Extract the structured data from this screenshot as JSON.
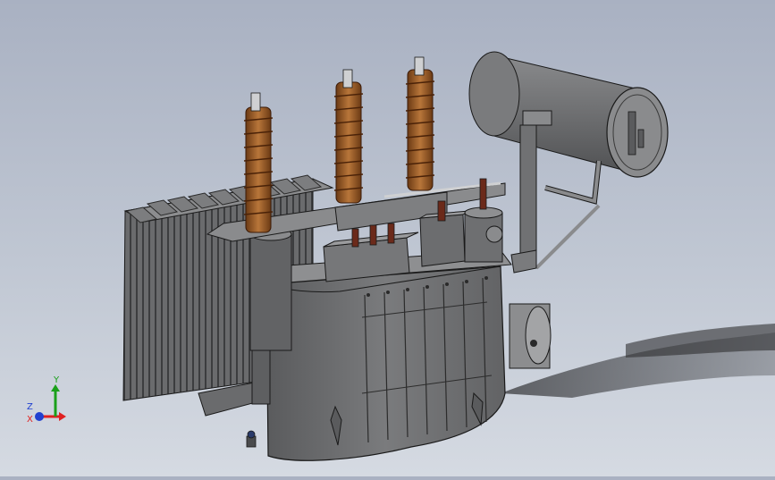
{
  "viewport": {
    "model_icon": "transformer-3d-model",
    "colors": {
      "background_top": "#a9b1c2",
      "background_bottom": "#d5dae2",
      "body": "#6f7072",
      "body_dark": "#4c4d4f",
      "edge": "#1a1a1a",
      "bushing": "#8a4e1e",
      "bushing_light": "#b8763a",
      "shadow": "#3a3b3e"
    }
  },
  "triad": {
    "x_label": "X",
    "y_label": "Y",
    "z_label": "Z",
    "colors": {
      "x": "#e02020",
      "y": "#1aa01a",
      "z": "#2040d0"
    }
  }
}
